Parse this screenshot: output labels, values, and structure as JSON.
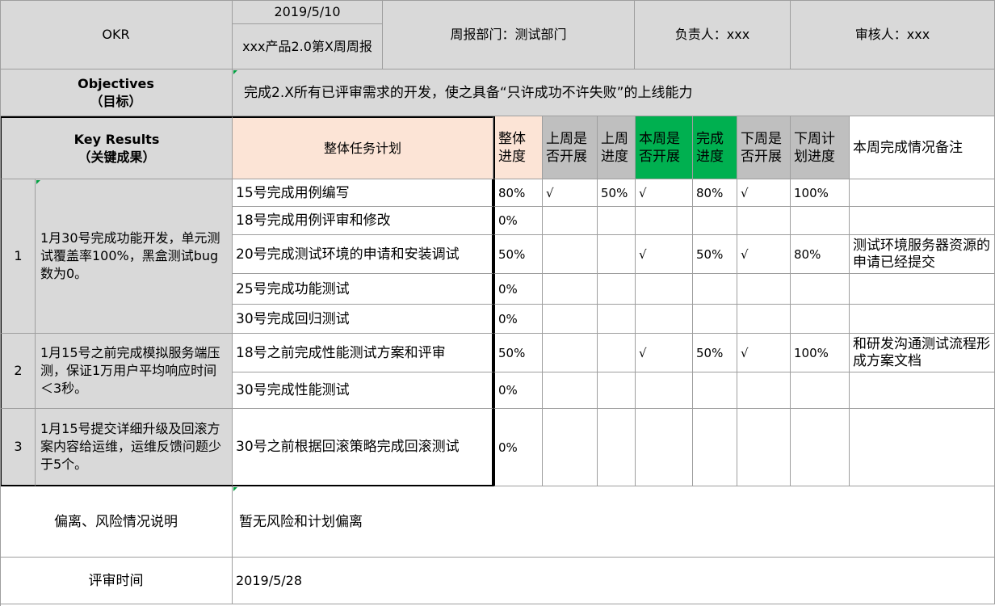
{
  "header": {
    "okr_label": "OKR",
    "date": "2019/5/10",
    "report_title": "xxx产品2.0第X周周报",
    "department": "周报部门：测试部门",
    "owner": "负责人：xxx",
    "reviewer": "审核人：xxx"
  },
  "objectives": {
    "label_line1": "Objectives",
    "label_line2": "（目标）",
    "text": "完成2.X所有已评审需求的开发，使之具备“只许成功不许失败”的上线能力"
  },
  "key_results_header": {
    "label_line1": "Key Results",
    "label_line2": "（关键成果）",
    "task_plan": "整体任务计划",
    "overall_progress": "整体进度",
    "last_week_started": "上周是否开展",
    "last_week_progress": "上周进度",
    "this_week_started": "本周是否开展",
    "completion_progress": "完成进度",
    "next_week_started": "下周是否开展",
    "next_week_plan": "下周计划进度",
    "remarks": "本周完成情况备注"
  },
  "key_results": [
    {
      "index": "1",
      "text": "1月30号完成功能开发，单元测试覆盖率100%，黑盒测试bug数为0。",
      "tasks": [
        {
          "task": "15号完成用例编写",
          "overall": "80%",
          "last_started": "√",
          "last_progress": "50%",
          "this_started": "√",
          "completion": "80%",
          "next_started": "√",
          "next_plan": "100%",
          "remark": ""
        },
        {
          "task": "18号完成用例评审和修改",
          "overall": "0%",
          "last_started": "",
          "last_progress": "",
          "this_started": "",
          "completion": "",
          "next_started": "",
          "next_plan": "",
          "remark": ""
        },
        {
          "task": "20号完成测试环境的申请和安装调试",
          "overall": "50%",
          "last_started": "",
          "last_progress": "",
          "this_started": "√",
          "completion": "50%",
          "next_started": "√",
          "next_plan": "80%",
          "remark": "测试环境服务器资源的申请已经提交"
        },
        {
          "task": "25号完成功能测试",
          "overall": "0%",
          "last_started": "",
          "last_progress": "",
          "this_started": "",
          "completion": "",
          "next_started": "",
          "next_plan": "",
          "remark": ""
        },
        {
          "task": "30号完成回归测试",
          "overall": "0%",
          "last_started": "",
          "last_progress": "",
          "this_started": "",
          "completion": "",
          "next_started": "",
          "next_plan": "",
          "remark": ""
        }
      ]
    },
    {
      "index": "2",
      "text": "1月15号之前完成模拟服务端压测，保证1万用户平均响应时间＜3秒。",
      "tasks": [
        {
          "task": "18号之前完成性能测试方案和评审",
          "overall": "50%",
          "last_started": "",
          "last_progress": "",
          "this_started": "√",
          "completion": "50%",
          "next_started": "√",
          "next_plan": "100%",
          "remark": "和研发沟通测试流程形成方案文档"
        },
        {
          "task": "30号完成性能测试",
          "overall": "0%",
          "last_started": "",
          "last_progress": "",
          "this_started": "",
          "completion": "",
          "next_started": "",
          "next_plan": "",
          "remark": ""
        }
      ]
    },
    {
      "index": "3",
      "text": "1月15号提交详细升级及回滚方案内容给运维，运维反馈问题少于5个。",
      "tasks": [
        {
          "task": "30号之前根据回滚策略完成回滚测试",
          "overall": "0%",
          "last_started": "",
          "last_progress": "",
          "this_started": "",
          "completion": "",
          "next_started": "",
          "next_plan": "",
          "remark": ""
        }
      ]
    }
  ],
  "risk": {
    "label": "偏离、风险情况说明",
    "text": "暂无风险和计划偏离"
  },
  "review": {
    "label": "评审时间",
    "date": "2019/5/28"
  },
  "colors": {
    "header_gray": "#d9d9d9",
    "peach": "#fce4d6",
    "green": "#00b050",
    "dark_gray": "#bfbfbf"
  }
}
